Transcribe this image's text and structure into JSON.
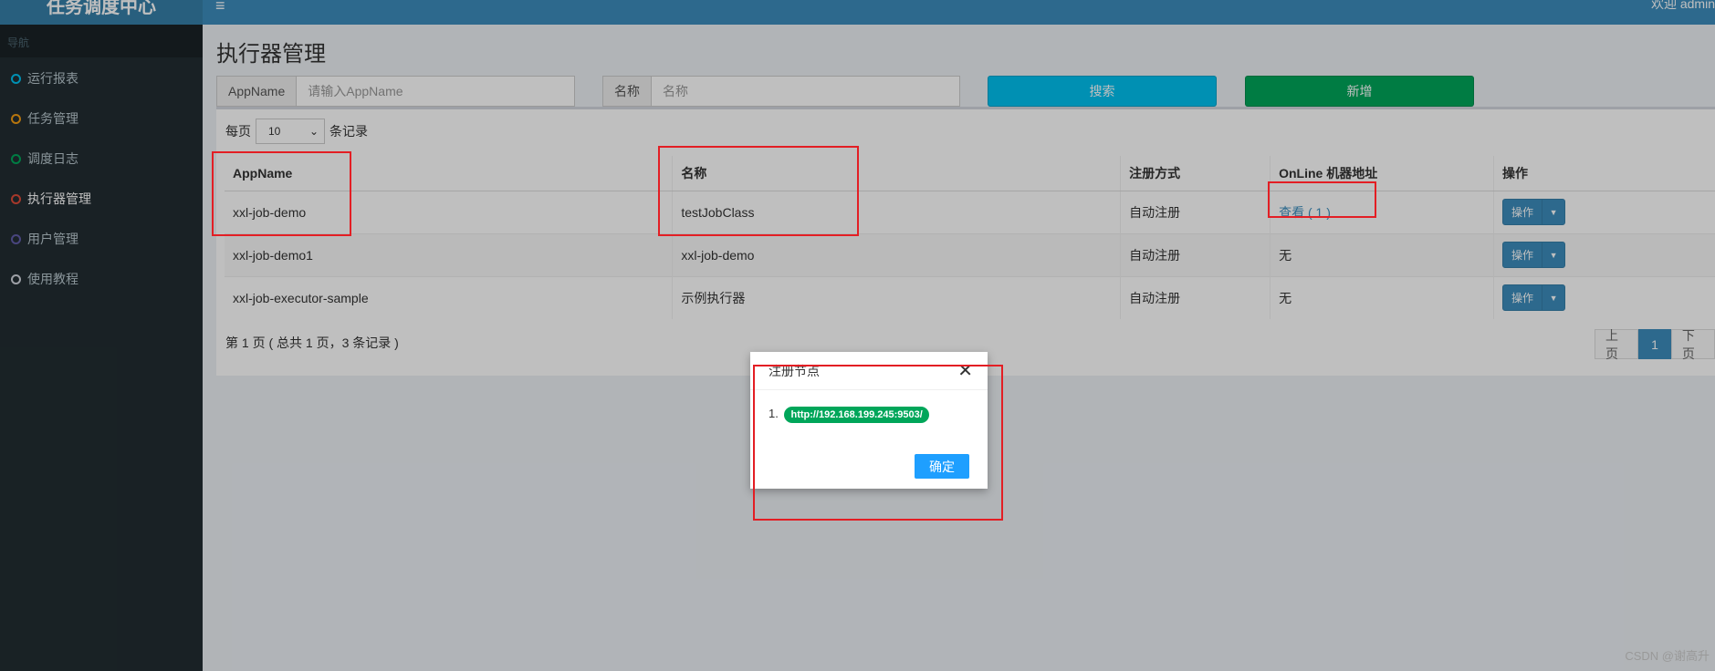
{
  "app": {
    "brand": "任务调度中心",
    "welcome": "欢迎 admin"
  },
  "sidebar": {
    "header": "导航",
    "items": [
      {
        "label": "运行报表",
        "color": "#00c0ef"
      },
      {
        "label": "任务管理",
        "color": "#f39c12"
      },
      {
        "label": "调度日志",
        "color": "#00a65a"
      },
      {
        "label": "执行器管理",
        "color": "#dd4b39"
      },
      {
        "label": "用户管理",
        "color": "#605ca8"
      },
      {
        "label": "使用教程",
        "color": "#d2d6de"
      }
    ]
  },
  "page": {
    "title": "执行器管理"
  },
  "filters": {
    "appname_label": "AppName",
    "appname_placeholder": "请输入AppName",
    "name_label": "名称",
    "name_placeholder": "名称",
    "search_button": "搜索",
    "add_button": "新增"
  },
  "table": {
    "per_page_prefix": "每页",
    "per_page_value": "10",
    "per_page_suffix": "条记录",
    "columns": [
      "AppName",
      "名称",
      "注册方式",
      "OnLine 机器地址",
      "操作"
    ],
    "rows": [
      {
        "appname": "xxl-job-demo",
        "name": "testJobClass",
        "reg": "自动注册",
        "online": "查看 ( 1 )",
        "op": "操作"
      },
      {
        "appname": "xxl-job-demo1",
        "name": "xxl-job-demo",
        "reg": "自动注册",
        "online": "无",
        "op": "操作"
      },
      {
        "appname": "xxl-job-executor-sample",
        "name": "示例执行器",
        "reg": "自动注册",
        "online": "无",
        "op": "操作"
      }
    ],
    "page_info": "第 1 页 ( 总共 1 页，3 条记录 )",
    "pager": {
      "prev": "上页",
      "current": "1",
      "next": "下页"
    }
  },
  "modal": {
    "title": "注册节点",
    "item_index": "1.",
    "address": "http://192.168.199.245:9503/",
    "ok_button": "确定"
  },
  "watermark": "CSDN @谢高升",
  "colors": {
    "annotation_red": "#e31e24",
    "brand_blue": "#3c8dbc"
  }
}
